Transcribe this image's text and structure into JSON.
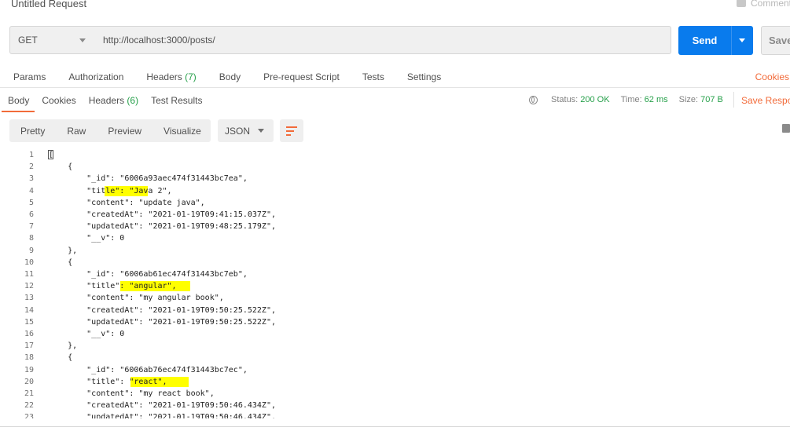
{
  "window": {
    "title": "Untitled Request",
    "comment_label": "Comment"
  },
  "request": {
    "method": "GET",
    "url": "http://localhost:3000/posts/",
    "send_label": "Send",
    "save_label": "Save"
  },
  "request_tabs": [
    {
      "label": "Params"
    },
    {
      "label": "Authorization"
    },
    {
      "label": "Headers",
      "count": "(7)"
    },
    {
      "label": "Body"
    },
    {
      "label": "Pre-request Script"
    },
    {
      "label": "Tests"
    },
    {
      "label": "Settings"
    }
  ],
  "cookies_label": "Cookies",
  "response_tabs": [
    {
      "label": "Body"
    },
    {
      "label": "Cookies"
    },
    {
      "label": "Headers",
      "count": "(6)"
    },
    {
      "label": "Test Results"
    }
  ],
  "status": {
    "status_label": "Status:",
    "status_value": "200 OK",
    "time_label": "Time:",
    "time_value": "62 ms",
    "size_label": "Size:",
    "size_value": "707 B",
    "save_response_label": "Save Respo"
  },
  "view_modes": [
    "Pretty",
    "Raw",
    "Preview",
    "Visualize"
  ],
  "format": "JSON",
  "colors": {
    "accent": "#f26b3a",
    "send": "#097bed",
    "ok": "#26a04a",
    "highlight": "#ffff00"
  },
  "code_lines": [
    "[",
    "    {",
    "        \"_id\": \"6006a93aec474f31443bc7ea\",",
    "        \"title\": \"Java 2\",",
    "        \"content\": \"update java\",",
    "        \"createdAt\": \"2021-01-19T09:41:15.037Z\",",
    "        \"updatedAt\": \"2021-01-19T09:48:25.179Z\",",
    "        \"__v\": 0",
    "    },",
    "    {",
    "        \"_id\": \"6006ab61ec474f31443bc7eb\",",
    "        \"title\": \"angular\",",
    "        \"content\": \"my angular book\",",
    "        \"createdAt\": \"2021-01-19T09:50:25.522Z\",",
    "        \"updatedAt\": \"2021-01-19T09:50:25.522Z\",",
    "        \"__v\": 0",
    "    },",
    "    {",
    "        \"_id\": \"6006ab76ec474f31443bc7ec\",",
    "        \"title\": \"react\",",
    "        \"content\": \"my react book\",",
    "        \"createdAt\": \"2021-01-19T09:50:46.434Z\",",
    "        \"updatedAt\": \"2021-01-19T09:50:46.434Z\","
  ]
}
